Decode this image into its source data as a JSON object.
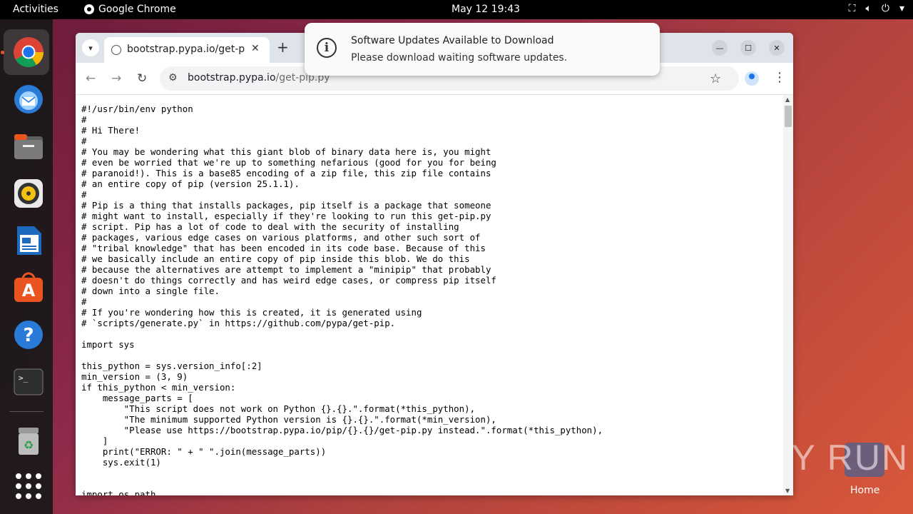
{
  "topbar": {
    "activities": "Activities",
    "app_name": "Google Chrome",
    "datetime": "May 12  19:43",
    "tray_icons": [
      "network-icon",
      "volume-icon",
      "power-icon",
      "menu-arrow-icon"
    ]
  },
  "dock": {
    "apps": [
      {
        "name": "Google Chrome",
        "icon": "chrome-icon",
        "color": "#1a73e8",
        "running": true
      },
      {
        "name": "Thunderbird",
        "icon": "thunderbird-icon",
        "color": "#2a7ad8"
      },
      {
        "name": "Files",
        "icon": "files-icon",
        "color": "#7a7a7a"
      },
      {
        "name": "Rhythmbox",
        "icon": "rhythmbox-icon",
        "color": "#f5c211"
      },
      {
        "name": "LibreOffice Writer",
        "icon": "writer-icon",
        "color": "#1e6ac1"
      },
      {
        "name": "Ubuntu Software",
        "icon": "software-icon",
        "color": "#e95420"
      },
      {
        "name": "Help",
        "icon": "help-icon",
        "color": "#2a7ad8"
      },
      {
        "name": "Terminal",
        "icon": "terminal-icon",
        "color": "#2e2e2e"
      },
      {
        "name": "Trash",
        "icon": "trash-icon",
        "color": "#888888"
      },
      {
        "name": "Show Applications",
        "icon": "app-grid-icon",
        "color": "#ffffff"
      }
    ]
  },
  "browser": {
    "tab_title": "bootstrap.pypa.io/get-pip.py",
    "url_host": "bootstrap.pypa.io",
    "url_path": "/get-pip.py",
    "code": "#!/usr/bin/env python\n#\n# Hi There!\n#\n# You may be wondering what this giant blob of binary data here is, you might\n# even be worried that we're up to something nefarious (good for you for being\n# paranoid!). This is a base85 encoding of a zip file, this zip file contains\n# an entire copy of pip (version 25.1.1).\n#\n# Pip is a thing that installs packages, pip itself is a package that someone\n# might want to install, especially if they're looking to run this get-pip.py\n# script. Pip has a lot of code to deal with the security of installing\n# packages, various edge cases on various platforms, and other such sort of\n# \"tribal knowledge\" that has been encoded in its code base. Because of this\n# we basically include an entire copy of pip inside this blob. We do this\n# because the alternatives are attempt to implement a \"minipip\" that probably\n# doesn't do things correctly and has weird edge cases, or compress pip itself\n# down into a single file.\n#\n# If you're wondering how this is created, it is generated using\n# `scripts/generate.py` in https://github.com/pypa/get-pip.\n\nimport sys\n\nthis_python = sys.version_info[:2]\nmin_version = (3, 9)\nif this_python < min_version:\n    message_parts = [\n        \"This script does not work on Python {}.{}.\".format(*this_python),\n        \"The minimum supported Python version is {}.{}.\".format(*min_version),\n        \"Please use https://bootstrap.pypa.io/pip/{}.{}/get-pip.py instead.\".format(*this_python),\n    ]\n    print(\"ERROR: \" + \" \".join(message_parts))\n    sys.exit(1)\n\n\nimport os.path"
  },
  "notification": {
    "title": "Software Updates Available to Download",
    "body": "Please download waiting software updates."
  },
  "desktop": {
    "home_label": "Home",
    "watermark": "ANY RUN"
  }
}
